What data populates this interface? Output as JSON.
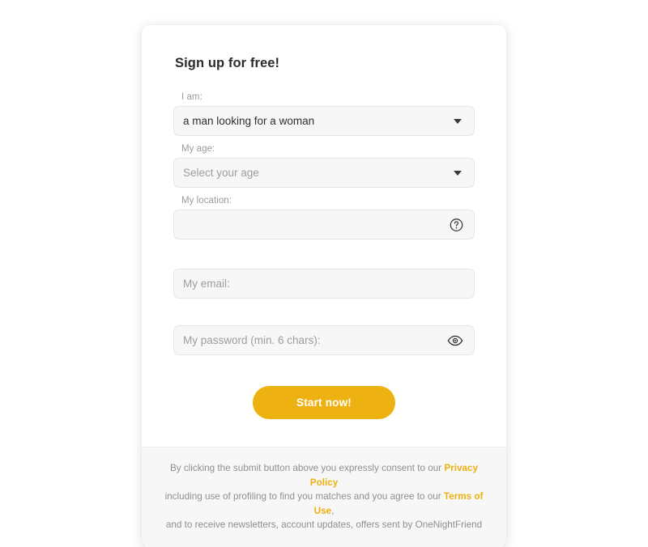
{
  "card": {
    "title": "Sign up for free!",
    "fields": {
      "gender": {
        "label": "I am:",
        "value": "a man looking for a woman",
        "caret_icon": "chevron-down-icon"
      },
      "age": {
        "label": "My age:",
        "value": "Select your age",
        "caret_icon": "chevron-down-icon"
      },
      "location": {
        "label": "My location:",
        "value": "",
        "placeholder": "",
        "help_icon": "question-mark-circle-icon"
      },
      "email": {
        "value": "",
        "placeholder": "My email:"
      },
      "password": {
        "value": "",
        "placeholder": "My password (min. 6 chars):",
        "reveal_icon": "eye-icon"
      }
    },
    "submit_label": "Start now!"
  },
  "footer": {
    "line1_before_link": "By clicking the submit button above you expressly consent to our ",
    "privacy_policy_link": "Privacy Policy",
    "line2_before_link": "including use of profiling to find you matches and you agree to our ",
    "terms_of_use_link": "Terms of Use",
    "line2_after_link": ",",
    "line3": "and to receive newsletters, account updates, offers sent by OneNightFriend"
  },
  "colors": {
    "accent": "#edb111",
    "field_background": "#f7f7f7",
    "card_background": "#ffffff",
    "text_primary": "#2b2b2b",
    "text_muted": "#9a9a9a"
  }
}
